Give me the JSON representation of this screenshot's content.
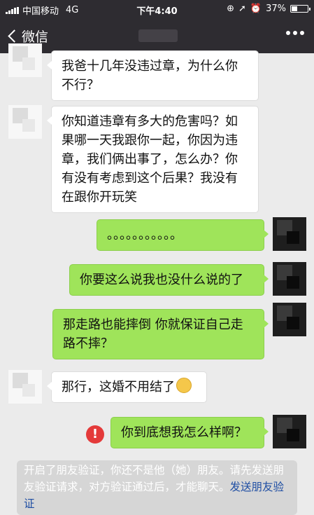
{
  "status_bar": {
    "carrier": "中国移动",
    "network": "4G",
    "time": "下午4:40",
    "battery": "37%",
    "battery_level": 0.37
  },
  "nav": {
    "back_label": "微信",
    "more_icon": "more-dots-icon"
  },
  "messages": [
    {
      "side": "left",
      "text": "我爸十几年没违过章，为什么你不行？"
    },
    {
      "side": "left",
      "text": "你知道违章有多大的危害吗？如果哪一天我跟你一起，你因为违章，我们俩出事了，怎么办？你有没有考虑到这个后果？我没有在跟你开玩笑"
    },
    {
      "side": "right",
      "text": "。。。。。。。。。。。"
    },
    {
      "side": "right",
      "text": "你要这么说我也没什么说的了"
    },
    {
      "side": "right",
      "text": "那走路也能摔倒 你就保证自己走路不摔？"
    },
    {
      "side": "left",
      "text": "那行，这婚不用结了",
      "emoji": "smile-emoji-icon"
    },
    {
      "side": "right",
      "text": "你到底想我怎么样啊？",
      "failed": true,
      "failed_icon": "!"
    }
  ],
  "system_notice": {
    "text": "开启了朋友验证，你还不是他（她）朋友。请先发送朋友验证请求，对方验证通过后，才能聊天。",
    "link": "发送朋友验证",
    "text_color": "#ffffff",
    "link_color": "#1f4ea3"
  },
  "colors": {
    "header_bg": "#2e2c31",
    "chat_bg": "#ebebeb",
    "green_bubble": "#9fe45a",
    "white_bubble": "#ffffff",
    "error_red": "#e43a3a"
  }
}
